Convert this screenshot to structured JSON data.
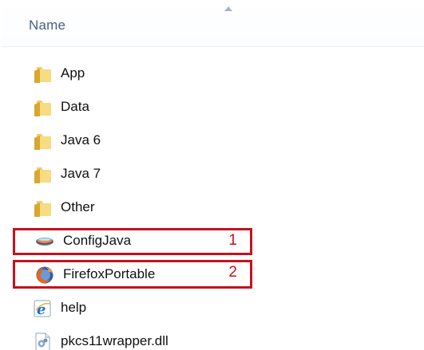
{
  "header": {
    "column_name": "Name"
  },
  "items": [
    {
      "label": "App",
      "icon": "folder-icon",
      "type": "folder"
    },
    {
      "label": "Data",
      "icon": "folder-icon",
      "type": "folder"
    },
    {
      "label": "Java 6",
      "icon": "folder-icon",
      "type": "folder"
    },
    {
      "label": "Java 7",
      "icon": "folder-icon",
      "type": "folder"
    },
    {
      "label": "Other",
      "icon": "folder-icon",
      "type": "folder"
    },
    {
      "label": "ConfigJava",
      "icon": "java-app-icon",
      "type": "application",
      "callout": "1"
    },
    {
      "label": "FirefoxPortable",
      "icon": "firefox-icon",
      "type": "application",
      "callout": "2"
    },
    {
      "label": "help",
      "icon": "internet-explorer-icon",
      "type": "shortcut"
    },
    {
      "label": "pkcs11wrapper.dll",
      "icon": "dll-file-icon",
      "type": "file"
    }
  ],
  "colors": {
    "callout_border": "#c4121f",
    "header_text": "#4a5f80",
    "folder": "#e8b84a"
  }
}
